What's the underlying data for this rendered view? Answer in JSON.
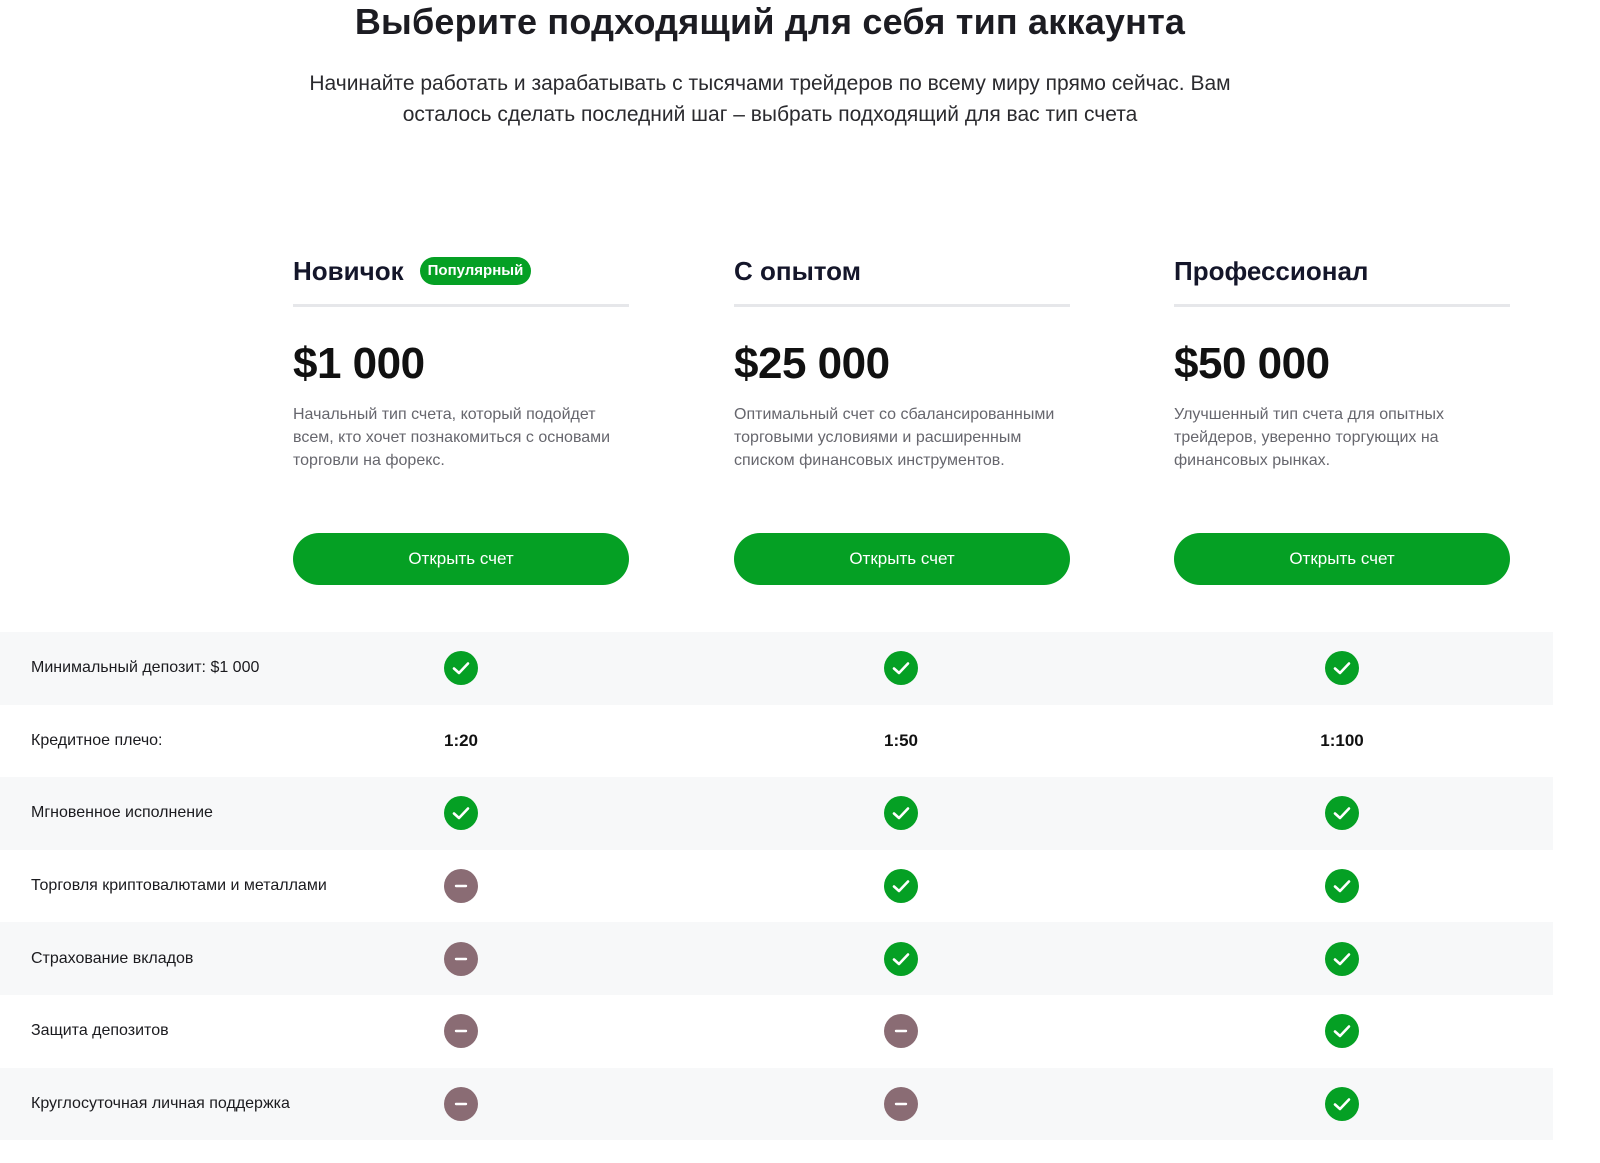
{
  "header": {
    "title": "Выберите подходящий для себя тип аккаунта",
    "subtitle_line1": "Начинайте работать и зарабатывать с тысячами трейдеров по всему миру прямо сейчас. Вам",
    "subtitle_line2": "осталось сделать последний шаг – выбрать подходящий для вас тип счета"
  },
  "colors": {
    "accent": "#05a024",
    "unavailable": "#8a6c74",
    "row_alt": "#f7f8f9"
  },
  "plans": [
    {
      "name": "Новичок",
      "badge": "Популярный",
      "price": "$1 000",
      "description": "Начальный тип счета, который подойдет всем, кто хочет познакомиться с основами торговли на форекс.",
      "button": "Открыть счет"
    },
    {
      "name": "С опытом",
      "price": "$25 000",
      "description": "Оптимальный счет со сбалансированными торговыми условиями и расширенным списком финансовых инструментов.",
      "button": "Открыть счет"
    },
    {
      "name": "Профессионал",
      "price": "$50 000",
      "description": "Улучшенный тип счета для опытных трейдеров, уверенно торгующих на финансовых рынках.",
      "button": "Открыть счет"
    }
  ],
  "features": [
    {
      "label": "Минимальный депозит: $1 000",
      "values": [
        "check",
        "check",
        "check"
      ]
    },
    {
      "label": "Кредитное плечо:",
      "values": [
        "1:20",
        "1:50",
        "1:100"
      ]
    },
    {
      "label": "Мгновенное исполнение",
      "values": [
        "check",
        "check",
        "check"
      ]
    },
    {
      "label": "Торговля криптовалютами и металлами",
      "values": [
        "minus",
        "check",
        "check"
      ]
    },
    {
      "label": "Страхование вкладов",
      "values": [
        "minus",
        "check",
        "check"
      ]
    },
    {
      "label": "Защита депозитов",
      "values": [
        "minus",
        "minus",
        "check"
      ]
    },
    {
      "label": "Круглосуточная личная поддержка",
      "values": [
        "minus",
        "minus",
        "check"
      ]
    }
  ]
}
